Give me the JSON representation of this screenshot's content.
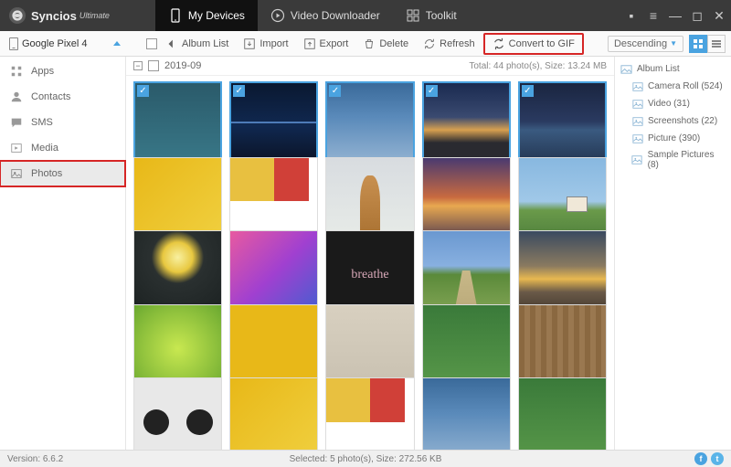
{
  "brand": {
    "name": "Syncios",
    "edition": "Ultimate"
  },
  "top_tabs": [
    {
      "label": "My Devices",
      "active": true
    },
    {
      "label": "Video Downloader",
      "active": false
    },
    {
      "label": "Toolkit",
      "active": false
    }
  ],
  "device": {
    "name": "Google Pixel 4"
  },
  "toolbar": {
    "album_list": "Album List",
    "import": "Import",
    "export": "Export",
    "delete": "Delete",
    "refresh": "Refresh",
    "convert_gif": "Convert to GIF",
    "sort_label": "Descending"
  },
  "left_nav": [
    {
      "key": "apps",
      "label": "Apps"
    },
    {
      "key": "contacts",
      "label": "Contacts"
    },
    {
      "key": "sms",
      "label": "SMS"
    },
    {
      "key": "media",
      "label": "Media"
    },
    {
      "key": "photos",
      "label": "Photos",
      "selected": true,
      "highlight": true
    }
  ],
  "group": {
    "name": "2019-09",
    "total_text": "Total: 44 photo(s), Size: 13.24 MB"
  },
  "thumbs": [
    {
      "sel": true,
      "art": "g-music"
    },
    {
      "sel": true,
      "art": "g-dark"
    },
    {
      "sel": true,
      "art": "g-light"
    },
    {
      "sel": true,
      "art": "g-sunset1"
    },
    {
      "sel": true,
      "art": "g-water"
    },
    {
      "sel": false,
      "art": "g-yellow"
    },
    {
      "sel": false,
      "art": "g-blocks"
    },
    {
      "sel": false,
      "art": "g-giraffe"
    },
    {
      "sel": false,
      "art": "g-sunset2"
    },
    {
      "sel": false,
      "art": "g-hills"
    },
    {
      "sel": false,
      "art": "g-arch"
    },
    {
      "sel": false,
      "art": "g-notes"
    },
    {
      "sel": false,
      "art": "g-breathe"
    },
    {
      "sel": false,
      "art": "g-path"
    },
    {
      "sel": false,
      "art": "g-dusk"
    },
    {
      "sel": false,
      "art": "g-leaf"
    },
    {
      "sel": false,
      "art": "g-yellow2"
    },
    {
      "sel": false,
      "art": "g-quote"
    },
    {
      "sel": false,
      "art": "g-green"
    },
    {
      "sel": false,
      "art": "g-wood"
    },
    {
      "sel": false,
      "art": "g-dj"
    },
    {
      "sel": false,
      "art": "g-yellow"
    },
    {
      "sel": false,
      "art": "g-blocks"
    },
    {
      "sel": false,
      "art": "g-light"
    },
    {
      "sel": false,
      "art": "g-green"
    }
  ],
  "right_pane": {
    "root": "Album List",
    "items": [
      {
        "label": "Camera Roll (524)"
      },
      {
        "label": "Video (31)"
      },
      {
        "label": "Screenshots (22)"
      },
      {
        "label": "Picture (390)"
      },
      {
        "label": "Sample Pictures (8)"
      }
    ]
  },
  "status": {
    "version": "Version: 6.6.2",
    "selection": "Selected: 5 photo(s), Size: 272.56 KB"
  }
}
